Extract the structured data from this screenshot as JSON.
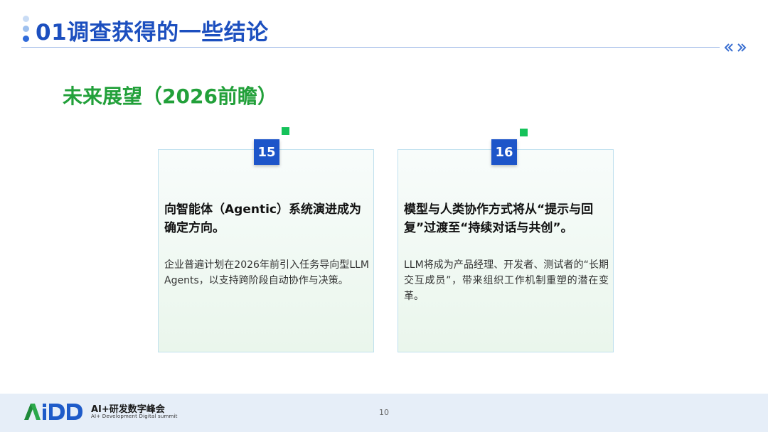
{
  "header": {
    "title": "01调查获得的一些结论",
    "accent_color": "#1c4fbf"
  },
  "section": {
    "subtitle": "未来展望（2026前瞻）",
    "subtitle_color": "#22a03a"
  },
  "cards": [
    {
      "number": "15",
      "heading": "向智能体（Agentic）系统演进成为确定方向。",
      "body": "企业普遍计划在2026年前引入任务导向型LLM Agents，以支持跨阶段自动协作与决策。"
    },
    {
      "number": "16",
      "heading": "模型与人类协作方式将从“提示与回复”过渡至“持续对话与共创”。",
      "body": "LLM将成为产品经理、开发者、测试者的“长期交互成员”，带来组织工作机制重塑的潜在变革。"
    }
  ],
  "footer": {
    "logo_text": "AiDD",
    "logo_cn": "AI+研发数字峰会",
    "logo_en": "AI+ Development Digital summit",
    "page_number": "10"
  },
  "icons": {
    "dots": "decorative-dots-icon",
    "chevrons": "double-chevron-icon"
  }
}
